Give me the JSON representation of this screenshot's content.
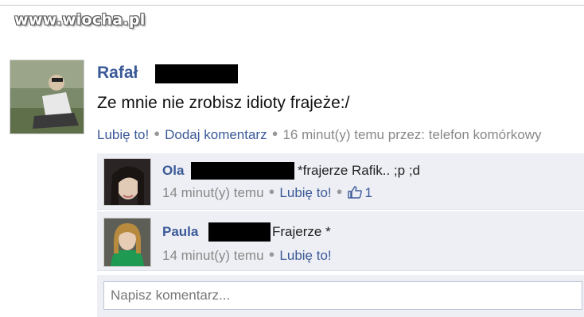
{
  "watermark": "www.wiocha.pl",
  "post": {
    "author": "Rafał",
    "text": "Ze mnie nie zrobisz idioty frajeże:/",
    "like_label": "Lubię to!",
    "comment_label": "Dodaj komentarz",
    "timestamp": "16 minut(y) temu przez: telefon komórkowy"
  },
  "comments": [
    {
      "author": "Ola",
      "text": "*frajerze Rafik.. ;p ;d",
      "timestamp": "14 minut(y) temu",
      "like_label": "Lubię to!",
      "like_count": "1"
    },
    {
      "author": "Paula",
      "text": "Frajerze *",
      "timestamp": "14 minut(y) temu",
      "like_label": "Lubię to!"
    }
  ],
  "comment_input": {
    "placeholder": "Napisz komentarz..."
  },
  "colors": {
    "link": "#3b5998",
    "comment_bg": "#edeff4",
    "meta_text": "#888888"
  }
}
